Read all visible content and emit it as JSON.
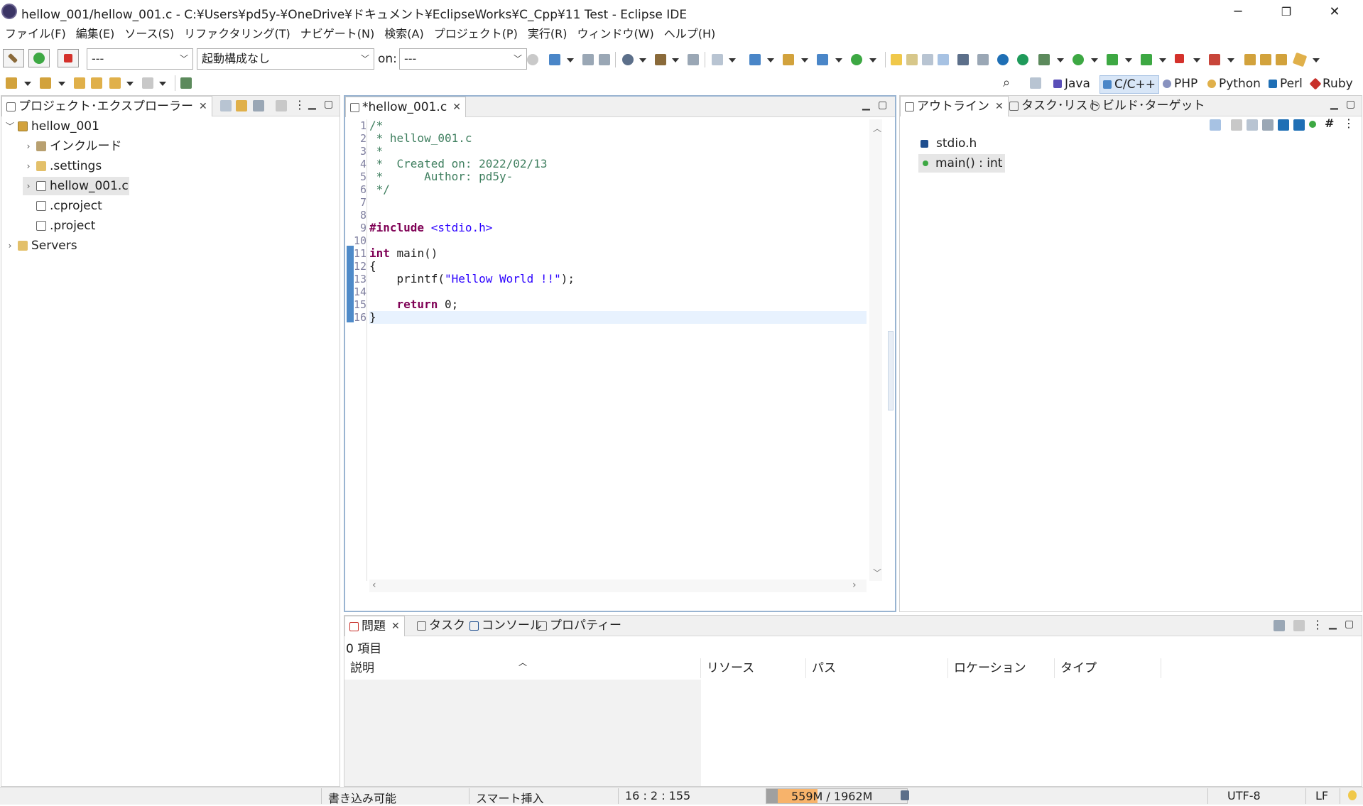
{
  "window": {
    "title": "hellow_001/hellow_001.c - C:¥Users¥pd5y-¥OneDrive¥ドキュメント¥EclipseWorks¥C_Cpp¥11 Test - Eclipse IDE",
    "minimize": "─",
    "restore": "❐",
    "close": "✕"
  },
  "menu": [
    "ファイル(F)",
    "編集(E)",
    "ソース(S)",
    "リファクタリング(T)",
    "ナビゲート(N)",
    "検索(A)",
    "プロジェクト(P)",
    "実行(R)",
    "ウィンドウ(W)",
    "ヘルプ(H)"
  ],
  "toolbar": {
    "launch_mode": "---",
    "launch_config": "起動構成なし",
    "on_label": "on:",
    "launch_target": "---"
  },
  "perspectives": [
    {
      "label": "Java",
      "active": false
    },
    {
      "label": "C/C++",
      "active": true
    },
    {
      "label": "PHP",
      "active": false
    },
    {
      "label": "Python",
      "active": false
    },
    {
      "label": "Perl",
      "active": false
    },
    {
      "label": "Ruby",
      "active": false
    }
  ],
  "explorer": {
    "title": "プロジェクト･エクスプローラー",
    "items": [
      {
        "label": "hellow_001",
        "twisty": "﹀",
        "icon": "project-icon"
      },
      {
        "label": "インクルード",
        "twisty": "›",
        "icon": "includes-icon"
      },
      {
        "label": ".settings",
        "twisty": "›",
        "icon": "folder-icon"
      },
      {
        "label": "hellow_001.c",
        "twisty": "›",
        "icon": "c-file-icon"
      },
      {
        "label": ".cproject",
        "twisty": "",
        "icon": "xml-file-icon"
      },
      {
        "label": ".project",
        "twisty": "",
        "icon": "xml-file-icon"
      },
      {
        "label": "Servers",
        "twisty": "›",
        "icon": "folder-icon"
      }
    ]
  },
  "editor": {
    "tab": "*hellow_001.c",
    "line_numbers": [
      "1",
      "2",
      "3",
      "4",
      "5",
      "6",
      "7",
      "8",
      "9",
      "10",
      "11",
      "12",
      "13",
      "14",
      "15",
      "16"
    ]
  },
  "outline": {
    "tabs": [
      "アウトライン",
      "タスク･リスト",
      "ビルド･ターゲット"
    ],
    "items": [
      "stdio.h",
      "main() : int"
    ]
  },
  "problems": {
    "tabs": [
      "問題",
      "タスク",
      "コンソール",
      "プロパティー"
    ],
    "summary": "0 項目",
    "columns": [
      "説明",
      "リソース",
      "パス",
      "ロケーション",
      "タイプ"
    ]
  },
  "status": {
    "writable": "書き込み可能",
    "insert_mode": "スマート挿入",
    "position": "16 : 2 : 155",
    "heap": "559M / 1962M",
    "encoding": "UTF-8",
    "line_ending": "LF"
  },
  "colors": {
    "accent": "#d8e6f7",
    "heap_fill": "#f7b36b",
    "keyword": "#7f0055",
    "comment": "#3f7f5f",
    "string": "#2a00ff",
    "current_line": "#e8f2fe"
  }
}
